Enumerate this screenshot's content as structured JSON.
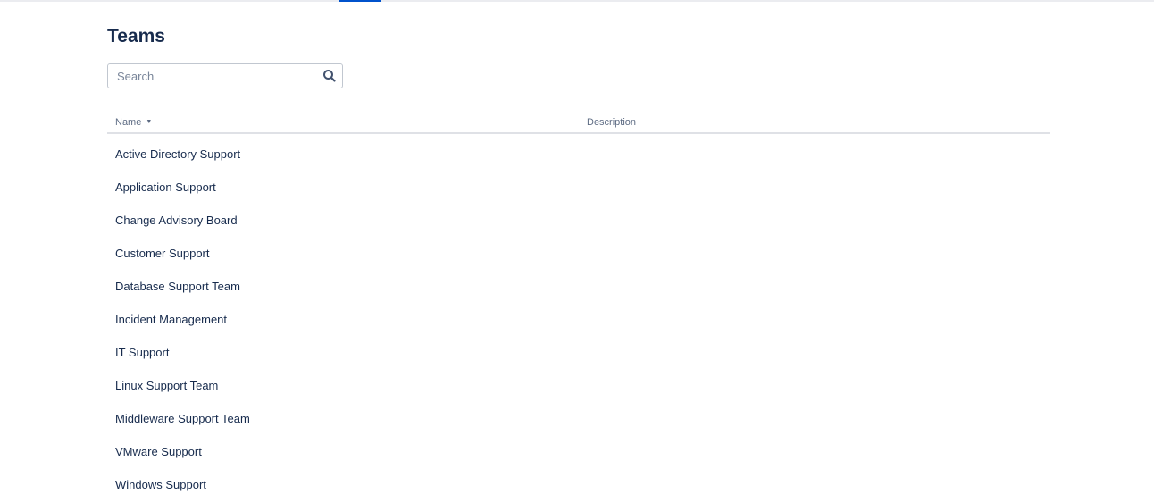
{
  "page": {
    "title": "Teams"
  },
  "search": {
    "placeholder": "Search",
    "value": ""
  },
  "table": {
    "columns": {
      "name": "Name",
      "description": "Description"
    },
    "sort_indicator": "▼",
    "rows": [
      {
        "name": "Active Directory Support",
        "description": ""
      },
      {
        "name": "Application Support",
        "description": ""
      },
      {
        "name": "Change Advisory Board",
        "description": ""
      },
      {
        "name": "Customer Support",
        "description": ""
      },
      {
        "name": "Database Support Team",
        "description": ""
      },
      {
        "name": "Incident Management",
        "description": ""
      },
      {
        "name": "IT Support",
        "description": ""
      },
      {
        "name": "Linux Support Team",
        "description": ""
      },
      {
        "name": "Middleware Support Team",
        "description": ""
      },
      {
        "name": "VMware Support",
        "description": ""
      },
      {
        "name": "Windows Support",
        "description": ""
      }
    ]
  },
  "colors": {
    "accent": "#0052cc",
    "text": "#172b4d",
    "subtle_text": "#5e6c84",
    "border": "#dfe1e6"
  }
}
